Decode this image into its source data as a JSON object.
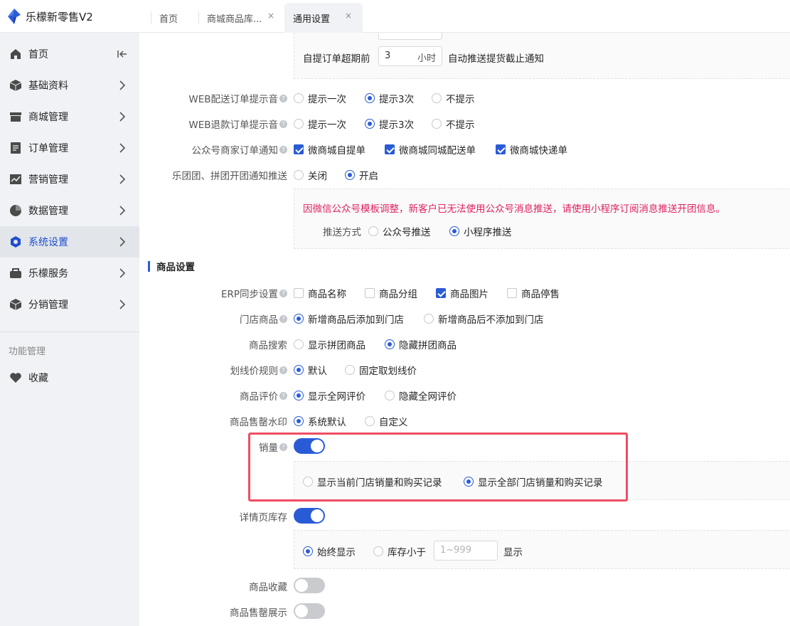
{
  "app": {
    "title": "乐檬新零售V2",
    "brand_color": "#2a5bd7"
  },
  "tabs": [
    {
      "label": "首页",
      "closable": false,
      "active": false
    },
    {
      "label": "商城商品库...",
      "closable": true,
      "active": false
    },
    {
      "label": "通用设置",
      "closable": true,
      "active": true
    }
  ],
  "tab_close_glyph": "×",
  "sidebar": {
    "items": [
      {
        "label": "首页",
        "icon": "home-icon",
        "trailing": "collapse-icon",
        "active": false
      },
      {
        "label": "基础资料",
        "icon": "cube-icon",
        "trailing": "chevron-right-icon",
        "active": false
      },
      {
        "label": "商城管理",
        "icon": "shop-icon",
        "trailing": "chevron-right-icon",
        "active": false
      },
      {
        "label": "订单管理",
        "icon": "clipboard-icon",
        "trailing": "chevron-right-icon",
        "active": false
      },
      {
        "label": "营销管理",
        "icon": "chart-icon",
        "trailing": "chevron-right-icon",
        "active": false
      },
      {
        "label": "数据管理",
        "icon": "pie-icon",
        "trailing": "chevron-right-icon",
        "active": false
      },
      {
        "label": "系统设置",
        "icon": "gear-icon",
        "trailing": "chevron-right-icon",
        "active": true
      },
      {
        "label": "乐檬服务",
        "icon": "service-icon",
        "trailing": "chevron-right-icon",
        "active": false
      },
      {
        "label": "分销管理",
        "icon": "box-icon",
        "trailing": "chevron-right-icon",
        "active": false
      }
    ],
    "section_label": "功能管理",
    "favorites": {
      "label": "收藏",
      "icon": "heart-icon"
    }
  },
  "settings": {
    "pickup_timeout": {
      "label": "自提订单超期前",
      "value": "3",
      "unit": "小时",
      "suffix": "自动推送提货截止通知"
    },
    "web_delivery_sound": {
      "label": "WEB配送订单提示音",
      "options": [
        "提示一次",
        "提示3次",
        "不提示"
      ],
      "selected": 1
    },
    "web_refund_sound": {
      "label": "WEB退款订单提示音",
      "options": [
        "提示一次",
        "提示3次",
        "不提示"
      ],
      "selected": 1
    },
    "oa_merchant_notify": {
      "label": "公众号商家订单通知",
      "options": [
        "微商城自提单",
        "微商城同城配送单",
        "微商城快递单"
      ],
      "checked": [
        true,
        true,
        true
      ]
    },
    "group_notify": {
      "label": "乐团团、拼团开团通知推送",
      "options": [
        "关闭",
        "开启"
      ],
      "selected": 1,
      "warning": "因微信公众号模板调整，新客户已无法使用公众号消息推送，请使用小程序订阅消息推送开团信息。",
      "push_method_label": "推送方式",
      "push_options": [
        "公众号推送",
        "小程序推送"
      ],
      "push_selected": 1
    },
    "goods_section_title": "商品设置",
    "erp_sync": {
      "label": "ERP同步设置",
      "options": [
        "商品名称",
        "商品分组",
        "商品图片",
        "商品停售"
      ],
      "checked": [
        false,
        false,
        true,
        false
      ]
    },
    "store_goods": {
      "label": "门店商品",
      "options": [
        "新增商品后添加到门店",
        "新增商品后不添加到门店"
      ],
      "selected": 0
    },
    "goods_search": {
      "label": "商品搜索",
      "options": [
        "显示拼团商品",
        "隐藏拼团商品"
      ],
      "selected": 1
    },
    "strike_price": {
      "label": "划线价规则",
      "options": [
        "默认",
        "固定取划线价"
      ],
      "selected": 0
    },
    "goods_review": {
      "label": "商品评价",
      "options": [
        "显示全网评价",
        "隐藏全网评价"
      ],
      "selected": 0
    },
    "soldout_watermark": {
      "label": "商品售罄水印",
      "options": [
        "系统默认",
        "自定义"
      ],
      "selected": 0
    },
    "sales_volume": {
      "label": "销量",
      "enabled": true,
      "options": [
        "显示当前门店销量和购买记录",
        "显示全部门店销量和购买记录"
      ],
      "selected": 1
    },
    "detail_stock": {
      "label": "详情页库存",
      "enabled": true,
      "options": [
        "始终显示",
        "库存小于"
      ],
      "selected": 0,
      "threshold_placeholder": "1~999",
      "threshold_suffix": "显示"
    },
    "goods_favorite": {
      "label": "商品收藏",
      "enabled": false
    },
    "soldout_display": {
      "label": "商品售罄展示",
      "enabled": false
    }
  },
  "colors": {
    "accent": "#2a5bd7",
    "warning_text": "#e0245e",
    "highlight_border": "#ef4d63"
  }
}
